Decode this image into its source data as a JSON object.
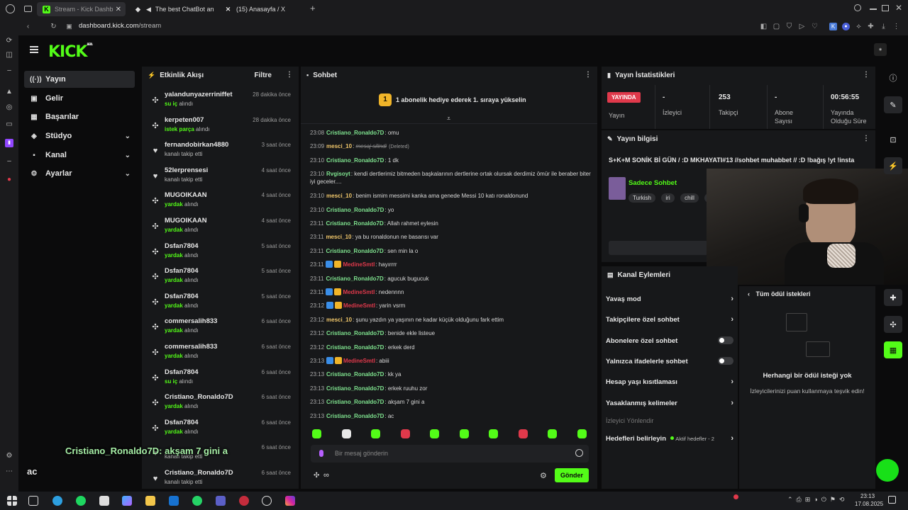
{
  "browser": {
    "tabs": [
      {
        "title": "Stream - Kick Dashb",
        "active": true,
        "icon": "kick-icon"
      },
      {
        "title": "The best ChatBot and",
        "active": false,
        "icon": "speaker-icon"
      },
      {
        "title": "(15) Anasayfa / X",
        "active": false,
        "icon": "x-icon"
      }
    ],
    "url_domain": "dashboard.kick.com",
    "url_path": "/stream"
  },
  "kick": {
    "logo": "KICK",
    "logo_sup": "BETA"
  },
  "nav": {
    "items": [
      {
        "label": "Yayın",
        "icon": "broadcast-icon",
        "active": true,
        "expandable": false
      },
      {
        "label": "Gelir",
        "icon": "wallet-icon",
        "active": false,
        "expandable": false
      },
      {
        "label": "Başarılar",
        "icon": "trophy-icon",
        "active": false,
        "expandable": false
      },
      {
        "label": "Stüdyo",
        "icon": "studio-icon",
        "active": false,
        "expandable": true
      },
      {
        "label": "Kanal",
        "icon": "channel-icon",
        "active": false,
        "expandable": true
      },
      {
        "label": "Ayarlar",
        "icon": "gear-icon",
        "active": false,
        "expandable": true
      }
    ]
  },
  "activity": {
    "title": "Etkinlik Akışı",
    "filter_label": "Filtre",
    "events": [
      {
        "user": "yalandunyazerriniffet",
        "time": "28 dakika önce",
        "highlight": "su iç",
        "action": "alındı",
        "type": "redeem"
      },
      {
        "user": "kerpeten007",
        "time": "28 dakika önce",
        "highlight": "istek parça",
        "action": "alındı",
        "type": "redeem"
      },
      {
        "user": "fernandobirkan4880",
        "time": "3 saat önce",
        "highlight": "",
        "action": "kanalı takip etti",
        "type": "follow"
      },
      {
        "user": "52lerprensesi",
        "time": "4 saat önce",
        "highlight": "",
        "action": "kanalı takip etti",
        "type": "follow"
      },
      {
        "user": "MUGOIKAAN",
        "time": "4 saat önce",
        "highlight": "yardak",
        "action": "alındı",
        "type": "redeem"
      },
      {
        "user": "MUGOIKAAN",
        "time": "4 saat önce",
        "highlight": "yardak",
        "action": "alındı",
        "type": "redeem"
      },
      {
        "user": "Dsfan7804",
        "time": "5 saat önce",
        "highlight": "yardak",
        "action": "alındı",
        "type": "redeem"
      },
      {
        "user": "Dsfan7804",
        "time": "5 saat önce",
        "highlight": "yardak",
        "action": "alındı",
        "type": "redeem"
      },
      {
        "user": "Dsfan7804",
        "time": "5 saat önce",
        "highlight": "yardak",
        "action": "alındı",
        "type": "redeem"
      },
      {
        "user": "commersalih833",
        "time": "6 saat önce",
        "highlight": "yardak",
        "action": "alındı",
        "type": "redeem"
      },
      {
        "user": "commersalih833",
        "time": "6 saat önce",
        "highlight": "yardak",
        "action": "alındı",
        "type": "redeem"
      },
      {
        "user": "Dsfan7804",
        "time": "6 saat önce",
        "highlight": "su iç",
        "action": "alındı",
        "type": "redeem"
      },
      {
        "user": "Cristiano_Ronaldo7D",
        "time": "6 saat önce",
        "highlight": "yardak",
        "action": "alındı",
        "type": "redeem"
      },
      {
        "user": "Dsfan7804",
        "time": "6 saat önce",
        "highlight": "yardak",
        "action": "alındı",
        "type": "redeem"
      },
      {
        "user": "",
        "time": "6 saat önce",
        "highlight": "",
        "action": "kanalı takip etti",
        "type": "follow"
      },
      {
        "user": "Cristiano_Ronaldo7D",
        "time": "6 saat önce",
        "highlight": "",
        "action": "kanalı takip etti",
        "type": "follow"
      }
    ]
  },
  "chat": {
    "title": "Sohbet",
    "banner": "1 abonelik hediye ederek 1. sıraya yükselin",
    "banner_badge": "1",
    "messages": [
      {
        "time": "23:08",
        "user": "Cristiano_Ronaldo7D",
        "color": "#7fe38f",
        "text": "omu"
      },
      {
        "time": "23:09",
        "user": "mesci_10",
        "color": "#f0c66a",
        "text": "mesaj silindi",
        "deleted": "(Deleted)"
      },
      {
        "time": "23:10",
        "user": "Cristiano_Ronaldo7D",
        "color": "#7fe38f",
        "text": "1 dk"
      },
      {
        "time": "23:10",
        "user": "Rvgisoyt",
        "color": "#7fe38f",
        "text": "kendi dertlerimiz bitmeden başkalarının dertlerine ortak olursak derdimiz ömür ile beraber biter iyi geceler...."
      },
      {
        "time": "23:10",
        "user": "mesci_10",
        "color": "#f0c66a",
        "text": "benim ismim messimi kanka ama genede Messi 10 katı ronaldonund"
      },
      {
        "time": "23:10",
        "user": "Cristiano_Ronaldo7D",
        "color": "#7fe38f",
        "text": "yo"
      },
      {
        "time": "23:11",
        "user": "Cristiano_Ronaldo7D",
        "color": "#7fe38f",
        "text": "Allah rahmet eylesin"
      },
      {
        "time": "23:11",
        "user": "mesci_10",
        "color": "#f0c66a",
        "text": "ya bu ronaldonun ne basarısı var"
      },
      {
        "time": "23:11",
        "user": "Cristiano_Ronaldo7D",
        "color": "#7fe38f",
        "text": "sen min la o"
      },
      {
        "time": "23:11",
        "user": "MedineSmtl",
        "color": "#e0394b",
        "text": "hayırrrr",
        "badges": true
      },
      {
        "time": "23:11",
        "user": "Cristiano_Ronaldo7D",
        "color": "#7fe38f",
        "text": "agucuk bugucuk"
      },
      {
        "time": "23:11",
        "user": "MedineSmtl",
        "color": "#e0394b",
        "text": "nedennnn",
        "badges": true
      },
      {
        "time": "23:12",
        "user": "MedineSmtl",
        "color": "#e0394b",
        "text": "yarin vsrm",
        "badges": true
      },
      {
        "time": "23:12",
        "user": "mesci_10",
        "color": "#f0c66a",
        "text": "şunu yazdın ya yaşının ne kadar küçük olduğunu fark ettim"
      },
      {
        "time": "23:12",
        "user": "Cristiano_Ronaldo7D",
        "color": "#7fe38f",
        "text": "benide ekle listeue"
      },
      {
        "time": "23:12",
        "user": "Cristiano_Ronaldo7D",
        "color": "#7fe38f",
        "text": "erkek derd"
      },
      {
        "time": "23:13",
        "user": "MedineSmtl",
        "color": "#e0394b",
        "text": "abiii",
        "badges": true
      },
      {
        "time": "23:13",
        "user": "Cristiano_Ronaldo7D",
        "color": "#7fe38f",
        "text": "kk ya"
      },
      {
        "time": "23:13",
        "user": "Cristiano_Ronaldo7D",
        "color": "#7fe38f",
        "text": "erkek ruuhu zor"
      },
      {
        "time": "23:13",
        "user": "Cristiano_Ronaldo7D",
        "color": "#7fe38f",
        "text": "akşam 7 gini a"
      },
      {
        "time": "23:13",
        "user": "Cristiano_Ronaldo7D",
        "color": "#7fe38f",
        "text": "ac"
      }
    ],
    "input_placeholder": "Bir mesaj gönderin",
    "send_label": "Gönder",
    "points_label": "∞"
  },
  "stats": {
    "title": "Yayın İstatistikleri",
    "live_label": "YAYINDA",
    "items": [
      {
        "value": "",
        "label": "Yayın"
      },
      {
        "value": "-",
        "label": "İzleyici"
      },
      {
        "value": "253",
        "label": "Takipçi"
      },
      {
        "value": "-",
        "label": "Abone Sayısı"
      },
      {
        "value": "00:56:55",
        "label": "Yayında Olduğu Süre"
      }
    ]
  },
  "stream_info": {
    "title": "Yayın bilgisi",
    "stream_title": "S+K+M SONİK Bİ GÜN / :D MKHAYATI#13 //sohbet muhabbet // :D !bağış !yt !insta",
    "category": "Sadece Sohbet",
    "tags": [
      "Turkish",
      "iri",
      "chill",
      "g"
    ]
  },
  "channel_actions": {
    "title": "Kanal Eylemleri",
    "items": [
      {
        "label": "Yavaş mod",
        "control": "arrow"
      },
      {
        "label": "Takipçilere özel sohbet",
        "control": "arrow"
      },
      {
        "label": "Abonelere özel sohbet",
        "control": "toggle"
      },
      {
        "label": "Yalnızca ifadelerle sohbet",
        "control": "toggle"
      },
      {
        "label": "Hesap yaşı kısıtlaması",
        "control": "arrow"
      },
      {
        "label": "Yasaklanmış kelimeler",
        "control": "arrow"
      }
    ],
    "viewer_redirect": "İzleyici Yönlendir",
    "goals_label": "Hedefleri belirleyin",
    "goals_status": "Aktif hedefler - 2"
  },
  "rewards": {
    "back_label": "Tüm ödül istekleri",
    "empty_title": "Herhangi bir ödül isteği yok",
    "empty_text": "İzleyicilerinizi puan kullanmaya teşvik edin!"
  },
  "overlay": {
    "caption": "Cristiano_Ronaldo7D: akşam 7 gini a",
    "caption2": "ac"
  },
  "taskbar": {
    "time": "23:13",
    "date": "17.08.2025"
  },
  "colors": {
    "accent": "#53fc18",
    "live": "#e0394b",
    "panel": "#17181a"
  }
}
